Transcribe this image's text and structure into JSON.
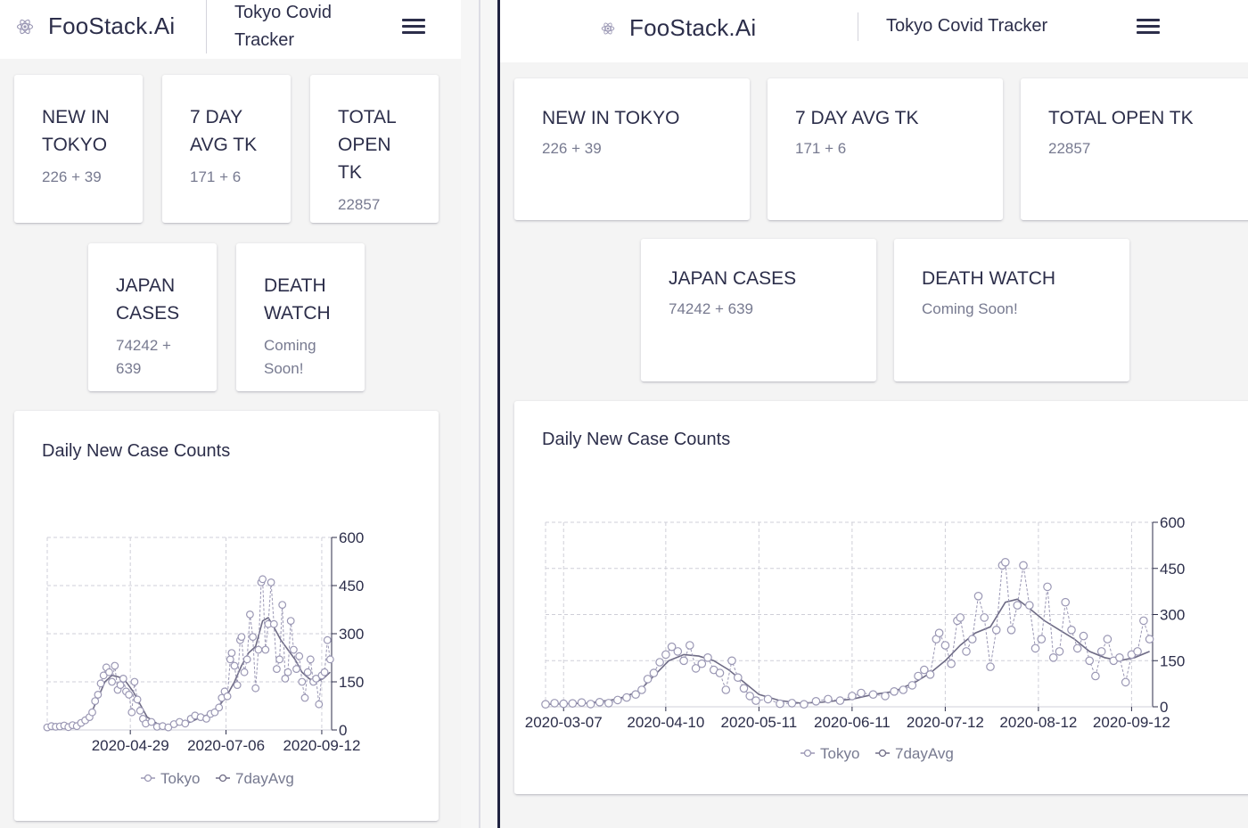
{
  "brand": {
    "name": "FooStack.Ai",
    "logo_icon": "atom-icon"
  },
  "header": {
    "app_title": "Tokyo Covid Tracker",
    "menu_icon": "hamburger-menu-icon"
  },
  "cards": {
    "new_in_tokyo": {
      "title": "NEW IN TOKYO",
      "value": "226 + 39"
    },
    "seven_day_avg": {
      "title": "7 DAY AVG TK",
      "value": "171 + 6"
    },
    "total_open": {
      "title": "TOTAL OPEN TK",
      "value": "22857"
    },
    "japan_cases": {
      "title": "JAPAN CASES",
      "value": "74242 + 639"
    },
    "death_watch": {
      "title": "DEATH WATCH",
      "value": "Coming Soon!"
    }
  },
  "chart": {
    "title": "Daily New Case Counts"
  },
  "colors": {
    "line": "#6e6b85",
    "marker": "#9a97b4",
    "grid": "#cfcfd8",
    "text": "#2c2e4a",
    "muted": "#777a90"
  },
  "chart_data": {
    "type": "line",
    "title": "Daily New Case Counts",
    "x_start": "2020-03-01",
    "x_end": "2020-09-19",
    "y_range": [
      0,
      600
    ],
    "y_axis_side": "right",
    "y_ticks": [
      0,
      150,
      300,
      450,
      600
    ],
    "grid": true,
    "legend_position": "bottom",
    "views": [
      {
        "x_tick_labels": [
          "2020-04-29",
          "2020-07-06",
          "2020-09-12"
        ]
      },
      {
        "x_tick_labels": [
          "2020-03-07",
          "2020-04-10",
          "2020-05-11",
          "2020-06-11",
          "2020-07-12",
          "2020-08-12",
          "2020-09-12"
        ]
      }
    ],
    "series": [
      {
        "name": "Tokyo",
        "style": "dashed-line-circle-markers"
      },
      {
        "name": "7dayAvg",
        "style": "solid-line"
      }
    ],
    "daily_points": [
      [
        "2020-03-01",
        8
      ],
      [
        "2020-03-04",
        12
      ],
      [
        "2020-03-07",
        10
      ],
      [
        "2020-03-10",
        11
      ],
      [
        "2020-03-13",
        14
      ],
      [
        "2020-03-16",
        9
      ],
      [
        "2020-03-19",
        15
      ],
      [
        "2020-03-22",
        12
      ],
      [
        "2020-03-25",
        22
      ],
      [
        "2020-03-28",
        30
      ],
      [
        "2020-03-31",
        40
      ],
      [
        "2020-04-02",
        55
      ],
      [
        "2020-04-04",
        90
      ],
      [
        "2020-04-06",
        110
      ],
      [
        "2020-04-08",
        145
      ],
      [
        "2020-04-10",
        170
      ],
      [
        "2020-04-12",
        195
      ],
      [
        "2020-04-14",
        180
      ],
      [
        "2020-04-16",
        150
      ],
      [
        "2020-04-18",
        200
      ],
      [
        "2020-04-20",
        125
      ],
      [
        "2020-04-22",
        140
      ],
      [
        "2020-04-24",
        160
      ],
      [
        "2020-04-26",
        120
      ],
      [
        "2020-04-28",
        110
      ],
      [
        "2020-04-30",
        55
      ],
      [
        "2020-05-02",
        150
      ],
      [
        "2020-05-04",
        95
      ],
      [
        "2020-05-06",
        60
      ],
      [
        "2020-05-08",
        35
      ],
      [
        "2020-05-10",
        20
      ],
      [
        "2020-05-14",
        25
      ],
      [
        "2020-05-18",
        10
      ],
      [
        "2020-05-22",
        12
      ],
      [
        "2020-05-26",
        8
      ],
      [
        "2020-05-30",
        18
      ],
      [
        "2020-06-03",
        25
      ],
      [
        "2020-06-07",
        20
      ],
      [
        "2020-06-11",
        35
      ],
      [
        "2020-06-14",
        45
      ],
      [
        "2020-06-18",
        40
      ],
      [
        "2020-06-22",
        35
      ],
      [
        "2020-06-25",
        50
      ],
      [
        "2020-06-28",
        55
      ],
      [
        "2020-07-01",
        70
      ],
      [
        "2020-07-03",
        100
      ],
      [
        "2020-07-05",
        120
      ],
      [
        "2020-07-07",
        105
      ],
      [
        "2020-07-09",
        220
      ],
      [
        "2020-07-10",
        240
      ],
      [
        "2020-07-12",
        200
      ],
      [
        "2020-07-14",
        140
      ],
      [
        "2020-07-16",
        280
      ],
      [
        "2020-07-17",
        290
      ],
      [
        "2020-07-19",
        180
      ],
      [
        "2020-07-21",
        220
      ],
      [
        "2020-07-23",
        360
      ],
      [
        "2020-07-25",
        290
      ],
      [
        "2020-07-27",
        130
      ],
      [
        "2020-07-29",
        250
      ],
      [
        "2020-07-31",
        460
      ],
      [
        "2020-08-01",
        470
      ],
      [
        "2020-08-03",
        250
      ],
      [
        "2020-08-05",
        330
      ],
      [
        "2020-08-07",
        460
      ],
      [
        "2020-08-09",
        330
      ],
      [
        "2020-08-11",
        190
      ],
      [
        "2020-08-13",
        220
      ],
      [
        "2020-08-15",
        390
      ],
      [
        "2020-08-17",
        160
      ],
      [
        "2020-08-19",
        180
      ],
      [
        "2020-08-21",
        340
      ],
      [
        "2020-08-23",
        250
      ],
      [
        "2020-08-25",
        190
      ],
      [
        "2020-08-27",
        230
      ],
      [
        "2020-08-29",
        150
      ],
      [
        "2020-08-31",
        100
      ],
      [
        "2020-09-02",
        180
      ],
      [
        "2020-09-04",
        220
      ],
      [
        "2020-09-06",
        150
      ],
      [
        "2020-09-08",
        160
      ],
      [
        "2020-09-10",
        80
      ],
      [
        "2020-09-12",
        170
      ],
      [
        "2020-09-14",
        180
      ],
      [
        "2020-09-16",
        280
      ],
      [
        "2020-09-18",
        220
      ]
    ],
    "avg_points": [
      [
        "2020-03-01",
        8
      ],
      [
        "2020-03-15",
        12
      ],
      [
        "2020-03-25",
        25
      ],
      [
        "2020-04-01",
        50
      ],
      [
        "2020-04-06",
        100
      ],
      [
        "2020-04-11",
        150
      ],
      [
        "2020-04-16",
        170
      ],
      [
        "2020-04-21",
        165
      ],
      [
        "2020-04-26",
        150
      ],
      [
        "2020-05-01",
        120
      ],
      [
        "2020-05-06",
        80
      ],
      [
        "2020-05-11",
        40
      ],
      [
        "2020-05-18",
        20
      ],
      [
        "2020-05-25",
        12
      ],
      [
        "2020-06-01",
        15
      ],
      [
        "2020-06-11",
        25
      ],
      [
        "2020-06-18",
        40
      ],
      [
        "2020-06-25",
        50
      ],
      [
        "2020-07-02",
        80
      ],
      [
        "2020-07-07",
        110
      ],
      [
        "2020-07-12",
        150
      ],
      [
        "2020-07-17",
        200
      ],
      [
        "2020-07-22",
        240
      ],
      [
        "2020-07-27",
        260
      ],
      [
        "2020-08-01",
        340
      ],
      [
        "2020-08-05",
        350
      ],
      [
        "2020-08-09",
        320
      ],
      [
        "2020-08-14",
        280
      ],
      [
        "2020-08-19",
        250
      ],
      [
        "2020-08-24",
        220
      ],
      [
        "2020-08-29",
        180
      ],
      [
        "2020-09-03",
        160
      ],
      [
        "2020-09-08",
        150
      ],
      [
        "2020-09-13",
        160
      ],
      [
        "2020-09-18",
        180
      ]
    ]
  }
}
